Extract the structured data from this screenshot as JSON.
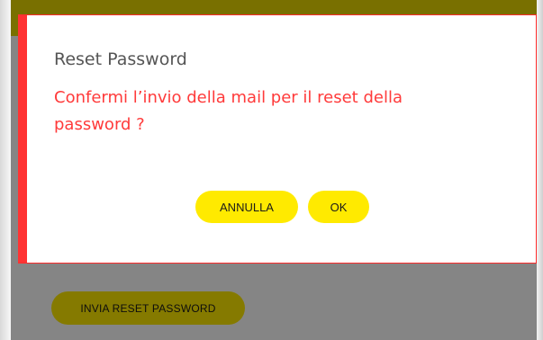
{
  "dialog": {
    "title": "Reset Password",
    "message": "Confermi l’invio della mail per il reset della password ?",
    "cancel_label": "ANNULLA",
    "ok_label": "OK"
  },
  "page": {
    "reset_button_label": "INVIA RESET PASSWORD"
  },
  "colors": {
    "accent_yellow": "#ffea00",
    "alert_red": "#ff3333",
    "overlay": "rgba(0,0,0,0.48)"
  }
}
